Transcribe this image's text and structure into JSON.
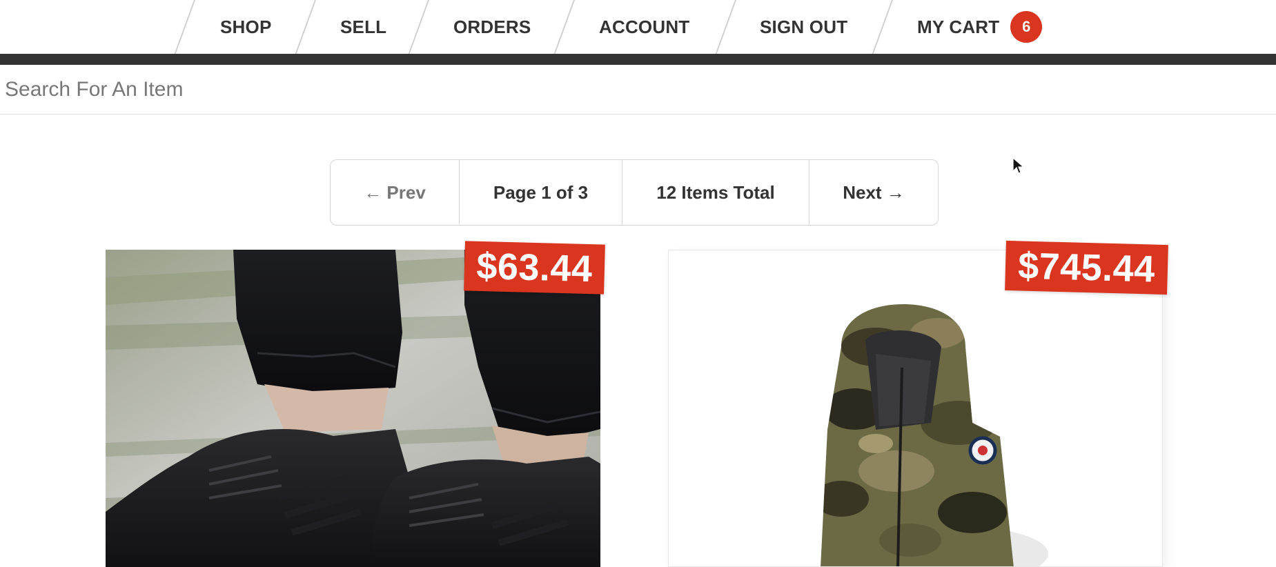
{
  "nav": {
    "items": [
      {
        "label": "SHOP"
      },
      {
        "label": "SELL"
      },
      {
        "label": "ORDERS"
      },
      {
        "label": "ACCOUNT"
      },
      {
        "label": "SIGN OUT"
      }
    ],
    "cart_label": "MY CART",
    "cart_count": "6"
  },
  "search": {
    "placeholder": "Search For An Item"
  },
  "pagination": {
    "prev_label": "← Prev",
    "page_label": "Page 1 of 3",
    "total_label": "12 Items Total",
    "next_label": "Next →"
  },
  "products": [
    {
      "price": "$63.44",
      "image_icon": "sneakers-photo"
    },
    {
      "price": "$745.44",
      "image_icon": "camo-jacket-photo"
    }
  ],
  "colors": {
    "accent_red": "#d9351f",
    "nav_dark": "#333333",
    "text": "#333333"
  }
}
